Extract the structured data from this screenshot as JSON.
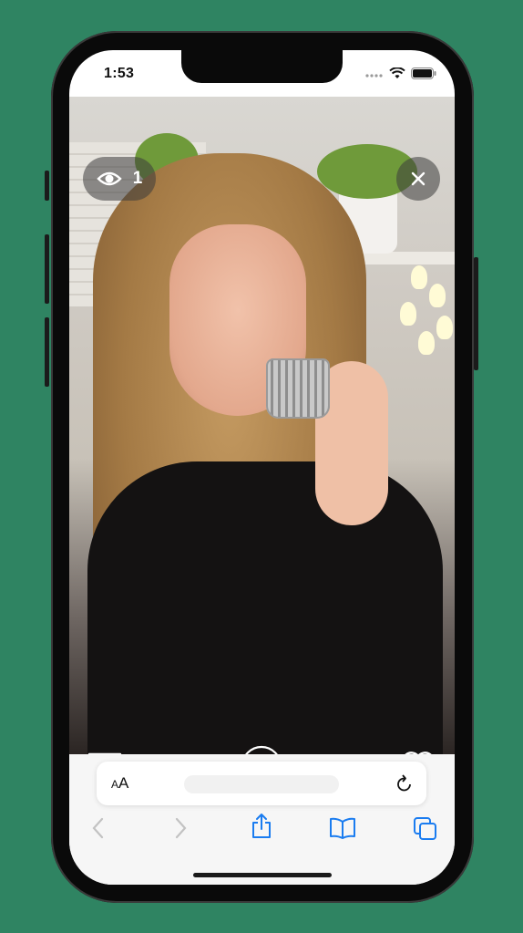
{
  "status_bar": {
    "time": "1:53",
    "signal_icon": "signal-icon",
    "wifi_icon": "wifi-icon",
    "battery_icon": "battery-icon"
  },
  "story": {
    "viewer_count": "1",
    "eye_icon": "eye-icon",
    "close_icon": "close-icon",
    "comment_icon": "chat-bubble-icon",
    "sound_icon": "speaker-icon",
    "like_icon": "heart-icon"
  },
  "safari": {
    "aa_label_small": "A",
    "aa_label_large": "A",
    "reload_icon": "reload-icon",
    "toolbar": [
      "back-icon",
      "forward-icon",
      "share-icon",
      "bookmarks-icon",
      "tabs-icon"
    ]
  },
  "colors": {
    "background": "#2f8462",
    "safari_blue": "#1a7cf0"
  }
}
